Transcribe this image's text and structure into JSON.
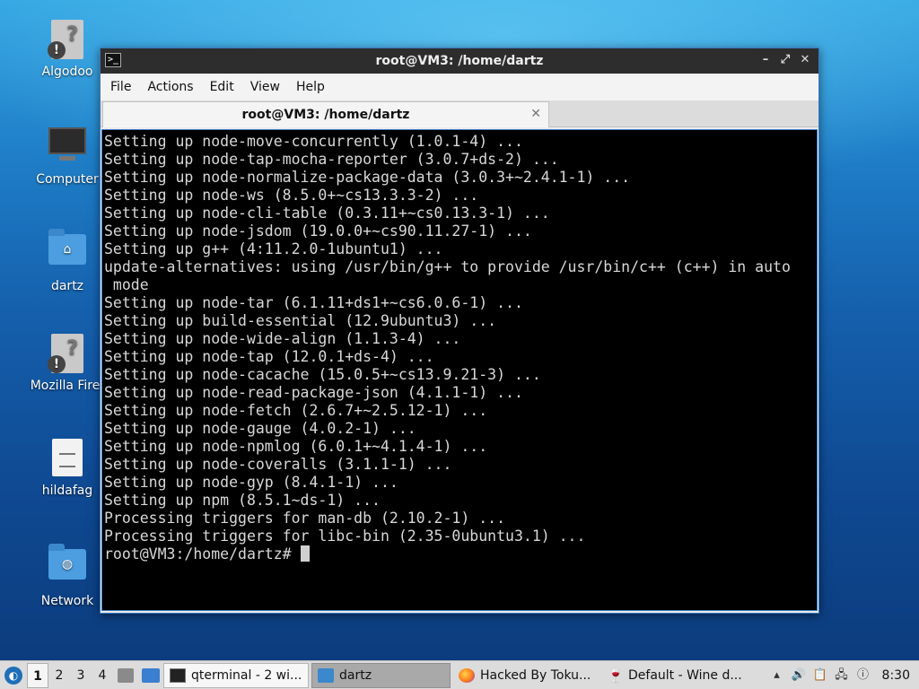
{
  "desktop": {
    "icons": [
      {
        "label": "Algodoo"
      },
      {
        "label": "Computer"
      },
      {
        "label": "dartz"
      },
      {
        "label": "Mozilla Firef"
      },
      {
        "label": "hildafag"
      },
      {
        "label": "Network"
      }
    ]
  },
  "window": {
    "title": "root@VM3: /home/dartz",
    "menu": [
      "File",
      "Actions",
      "Edit",
      "View",
      "Help"
    ],
    "tab_label": "root@VM3: /home/dartz",
    "terminal_lines": [
      "Setting up node-move-concurrently (1.0.1-4) ...",
      "Setting up node-tap-mocha-reporter (3.0.7+ds-2) ...",
      "Setting up node-normalize-package-data (3.0.3+~2.4.1-1) ...",
      "Setting up node-ws (8.5.0+~cs13.3.3-2) ...",
      "Setting up node-cli-table (0.3.11+~cs0.13.3-1) ...",
      "Setting up node-jsdom (19.0.0+~cs90.11.27-1) ...",
      "Setting up g++ (4:11.2.0-1ubuntu1) ...",
      "update-alternatives: using /usr/bin/g++ to provide /usr/bin/c++ (c++) in auto",
      " mode",
      "Setting up node-tar (6.1.11+ds1+~cs6.0.6-1) ...",
      "Setting up build-essential (12.9ubuntu3) ...",
      "Setting up node-wide-align (1.1.3-4) ...",
      "Setting up node-tap (12.0.1+ds-4) ...",
      "Setting up node-cacache (15.0.5+~cs13.9.21-3) ...",
      "Setting up node-read-package-json (4.1.1-1) ...",
      "Setting up node-fetch (2.6.7+~2.5.12-1) ...",
      "Setting up node-gauge (4.0.2-1) ...",
      "Setting up node-npmlog (6.0.1+~4.1.4-1) ...",
      "Setting up node-coveralls (3.1.1-1) ...",
      "Setting up node-gyp (8.4.1-1) ...",
      "Setting up npm (8.5.1~ds-1) ...",
      "Processing triggers for man-db (2.10.2-1) ...",
      "Processing triggers for libc-bin (2.35-0ubuntu3.1) ..."
    ],
    "prompt": "root@VM3:/home/dartz# "
  },
  "taskbar": {
    "workspaces": [
      "1",
      "2",
      "3",
      "4"
    ],
    "tasks": [
      {
        "label": "qterminal - 2 wi..."
      },
      {
        "label": "dartz"
      },
      {
        "label": "Hacked By Toku..."
      },
      {
        "label": "Default - Wine d..."
      }
    ],
    "clock": "8:30"
  },
  "icons": {
    "start": "lubuntu-logo-icon",
    "volume": "speaker-icon",
    "clipboard": "clipboard-icon",
    "network": "network-icon",
    "update": "update-notifier-icon"
  },
  "colors": {
    "terminal_bg": "#000000",
    "terminal_fg": "#d8d8d8",
    "titlebar_bg": "#2d2d2d",
    "accent": "#3a79c2"
  }
}
